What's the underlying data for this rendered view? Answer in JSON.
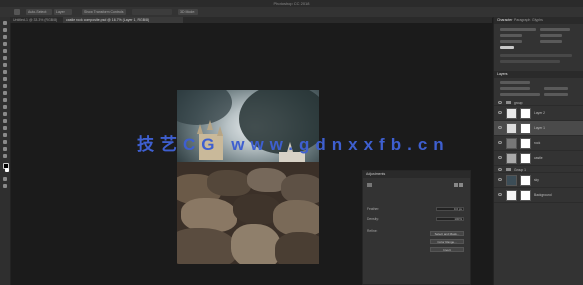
{
  "window": {
    "title": "Photoshop CC 2018",
    "traffic_lights": [
      "#ff5f57",
      "#febc2e",
      "#28c840"
    ]
  },
  "options_bar": {
    "items": [
      "Auto-Select:",
      "Layer",
      "Show Transform Controls",
      "3D Mode:"
    ]
  },
  "document_tabs": [
    {
      "label": "Untitled-1 @ 33.3% (RGB/8)",
      "active": false
    },
    {
      "label": "castle rock composite.psd @ 16.7% (Layer 1, RGB/8)",
      "active": true
    }
  ],
  "canvas": {
    "watermark": "技艺CG www.gdnxxfb.cn"
  },
  "properties": {
    "title": "Adjustments",
    "fields": [
      {
        "label": "Feather:",
        "value": "0.0 px"
      },
      {
        "label": "Density:",
        "value": "100%"
      },
      {
        "label": "Refine:",
        "value": ""
      }
    ],
    "buttons": [
      "Select and Mask...",
      "Color Range...",
      "Invert"
    ]
  },
  "right_panel": {
    "tabs": [
      "Character",
      "Paragraph",
      "Glyphs"
    ],
    "layers_tab": "Layers"
  },
  "layers": [
    {
      "type": "group",
      "name": "group"
    },
    {
      "type": "layer",
      "name": "Layer 2",
      "thumb": "#e8e8e8",
      "selected": false
    },
    {
      "type": "layer",
      "name": "Layer 1",
      "thumb": "#dcdcdc",
      "selected": true
    },
    {
      "type": "layer",
      "name": "rock",
      "thumb": "#777777",
      "selected": false
    },
    {
      "type": "layer",
      "name": "castle",
      "thumb": "#aaaaaa",
      "selected": false
    },
    {
      "type": "group",
      "name": "Group 1"
    },
    {
      "type": "layer",
      "name": "sky",
      "thumb": "#3c4d57",
      "selected": false
    },
    {
      "type": "layer",
      "name": "Background",
      "thumb": "#f4f4f4",
      "selected": false
    }
  ]
}
